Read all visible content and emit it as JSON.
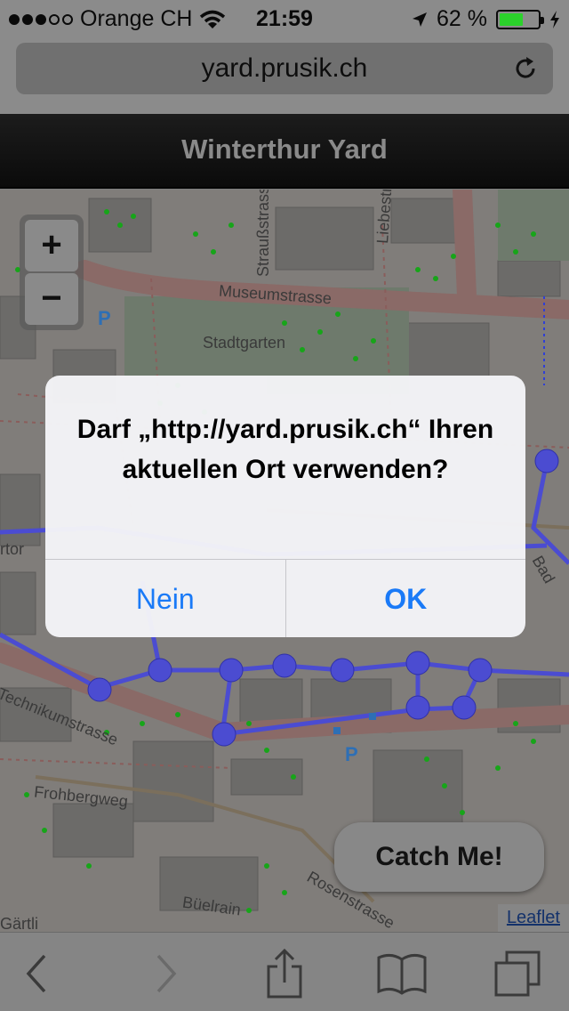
{
  "status_bar": {
    "carrier": "Orange CH",
    "time": "21:59",
    "battery_text": "62 %",
    "battery_level": 0.62,
    "signal_bars_on": 3,
    "signal_bars_total": 5,
    "icons": [
      "wifi-icon",
      "location-arrow-icon",
      "battery-icon"
    ]
  },
  "browser": {
    "url": "yard.prusik.ch",
    "toolbar_icons": [
      "back-icon",
      "forward-icon",
      "share-icon",
      "bookmarks-icon",
      "tabs-icon"
    ]
  },
  "page": {
    "title": "Winterthur Yard"
  },
  "map": {
    "zoom_in_label": "+",
    "zoom_out_label": "−",
    "street_labels": [
      "Museumstrasse",
      "Stadtgarten",
      "Technikumstrasse",
      "Frohbergweg",
      "Strauß­strasse",
      "Liebestrasse",
      "Rosenstrasse",
      "Büelrain",
      "Gärtli",
      "Bad",
      "rtor"
    ],
    "attribution": "Leaflet",
    "catch_button": "Catch Me!"
  },
  "alert": {
    "message": "Darf „http://yard.prusik.ch“ Ihren aktuellen Ort verwenden?",
    "cancel_label": "Nein",
    "confirm_label": "OK"
  },
  "colors": {
    "alert_button": "#1a7af7",
    "route": "#4b4cd1",
    "battery": "#2bd12b"
  }
}
